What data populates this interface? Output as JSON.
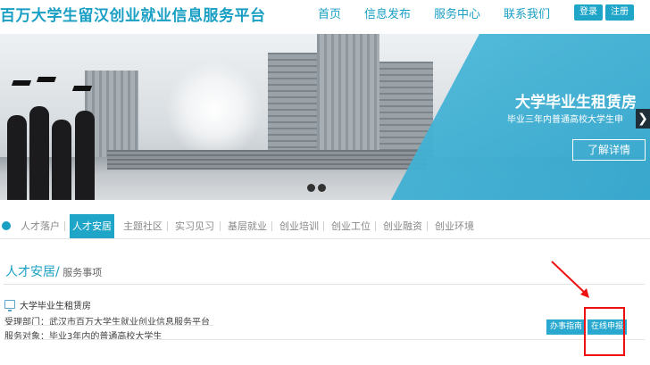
{
  "header": {
    "site_title": "百万大学生留汉创业就业信息服务平台",
    "nav": [
      "首页",
      "信息发布",
      "服务中心",
      "联系我们"
    ],
    "login_label": "登录",
    "register_label": "注册"
  },
  "banner": {
    "title": "大学毕业生租赁房",
    "subtitle": "毕业三年内普通高校大学生申",
    "arrow": "❯",
    "learn_more_label": "了解详情"
  },
  "tabs": [
    "人才落户",
    "人才安居",
    "主题社区",
    "实习见习",
    "基层就业",
    "创业培训",
    "创业工位",
    "创业融资",
    "创业环境"
  ],
  "active_tab_index": 1,
  "section": {
    "title": "人才安居/",
    "subtitle": " 服务事项",
    "item_title": "大学毕业生租赁房",
    "department_label": "受理部门：",
    "department_value": "武汉市百万大学生就业创业信息服务平台",
    "target_label": "服务对象：",
    "target_value": "毕业3年内的普通高校大学生",
    "guide_button": "办事指南",
    "apply_button": "在线申报"
  },
  "colors": {
    "accent": "#1a9fc4",
    "highlight": "#ee1111"
  }
}
